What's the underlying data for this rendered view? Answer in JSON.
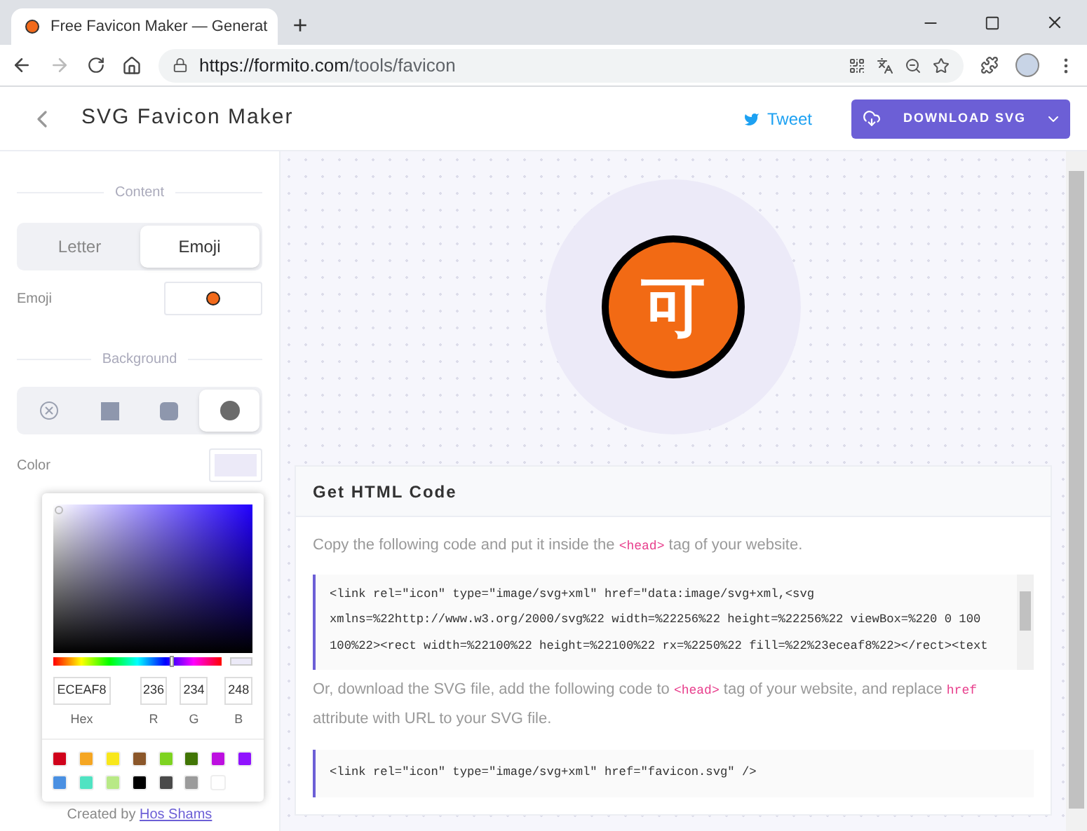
{
  "browser": {
    "tab_title": "Free Favicon Maker — Generat",
    "new_tab": "+",
    "url_host": "https://formito.com",
    "url_path": "/tools/favicon"
  },
  "header": {
    "title": "SVG Favicon Maker",
    "tweet": "Tweet",
    "download": "DOWNLOAD SVG"
  },
  "sidebar": {
    "content_heading": "Content",
    "content_tabs": [
      {
        "label": "Letter",
        "selected": false
      },
      {
        "label": "Emoji",
        "selected": true
      }
    ],
    "emoji_label": "Emoji",
    "background_heading": "Background",
    "shapes": [
      {
        "kind": "none",
        "selected": false
      },
      {
        "kind": "square",
        "selected": false
      },
      {
        "kind": "rounded",
        "selected": false
      },
      {
        "kind": "circle",
        "selected": true
      }
    ],
    "color_label": "Color",
    "color": "#eceaf8",
    "credit": "Created by",
    "credit_link": "Hos Shams"
  },
  "color_picker": {
    "hue": {
      "level": 0.69
    },
    "hex": "ECEAF8",
    "r": "236",
    "g": "234",
    "b": "248",
    "hex_label": "Hex",
    "r_label": "R",
    "g_label": "G",
    "b_label": "B",
    "swatches": [
      {
        "color": "#d0021b"
      },
      {
        "color": "#f5a623"
      },
      {
        "color": "#f8e71c"
      },
      {
        "color": "#8b572a"
      },
      {
        "color": "#7ed321"
      },
      {
        "color": "#417505"
      },
      {
        "color": "#bd10e0"
      },
      {
        "color": "#9013fe"
      },
      {
        "color": "#4a90e2"
      },
      {
        "color": "#50e3c2"
      },
      {
        "color": "#b8e986"
      },
      {
        "color": "#000000"
      },
      {
        "color": "#4a4a4a"
      },
      {
        "color": "#9b9b9b"
      },
      {
        "color": "#ffffff"
      }
    ]
  },
  "preview": {
    "character": "可"
  },
  "html_card": {
    "title": "Get HTML Code",
    "intro": [
      "Copy the following code and put it inside the ",
      "<head>",
      " tag of your website."
    ],
    "code_lines": [
      "<link rel=\"icon\" type=\"image/svg+xml\" href=\"data:image/svg+xml,<svg",
      "xmlns=%22http://www.w3.org/2000/svg%22 width=%22256%22 height=%22256%22 viewBox=%220 0 100",
      "100%22><rect width=%22100%22 height=%22100%22 rx=%2250%22 fill=%22%23eceaf8%22></rect><text"
    ],
    "outro": [
      "Or, download the SVG file, add the following code to ",
      "<head>",
      " tag of your website, and replace ",
      "href",
      " attribute with URL to your SVG file."
    ],
    "code2": "<link rel=\"icon\" type=\"image/svg+xml\" href=\"favicon.svg\" />"
  }
}
